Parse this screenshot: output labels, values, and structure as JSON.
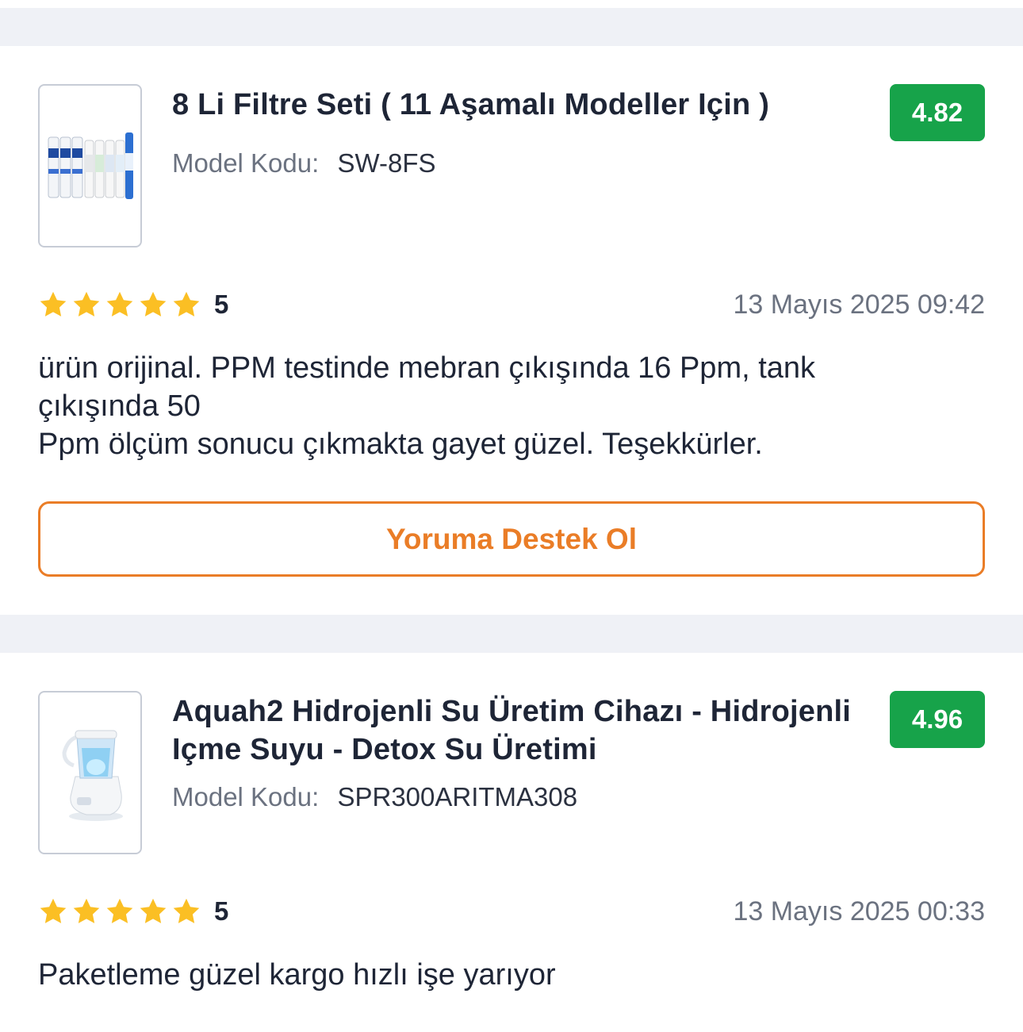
{
  "reviews": [
    {
      "product_title": "8 Li Filtre Seti ( 11 Aşamalı Modeller Için )",
      "model_label": "Model Kodu:",
      "model_code": "SW-8FS",
      "product_rating": "4.82",
      "stars": 5,
      "score": "5",
      "date": "13 Mayıs 2025 09:42",
      "text": "ürün orijinal. PPM testinde mebran çıkışında 16 Ppm, tank\nçıkışında 50\nPpm ölçüm sonucu çıkmakta gayet güzel. Teşekkürler.",
      "support_label": "Yoruma Destek Ol"
    },
    {
      "product_title": "Aquah2 Hidrojenli Su Üretim Cihazı - Hidrojenli Içme Suyu - Detox Su Üretimi",
      "model_label": "Model Kodu:",
      "model_code": "SPR300ARITMA308",
      "product_rating": "4.96",
      "stars": 5,
      "score": "5",
      "date": "13 Mayıs 2025 00:33",
      "text": "Paketleme güzel kargo hızlı işe yarıyor"
    }
  ],
  "colors": {
    "rating_badge": "#17a34a",
    "star": "#fbbf24",
    "accent_orange": "#ea7d27",
    "separator": "#eff1f6"
  }
}
